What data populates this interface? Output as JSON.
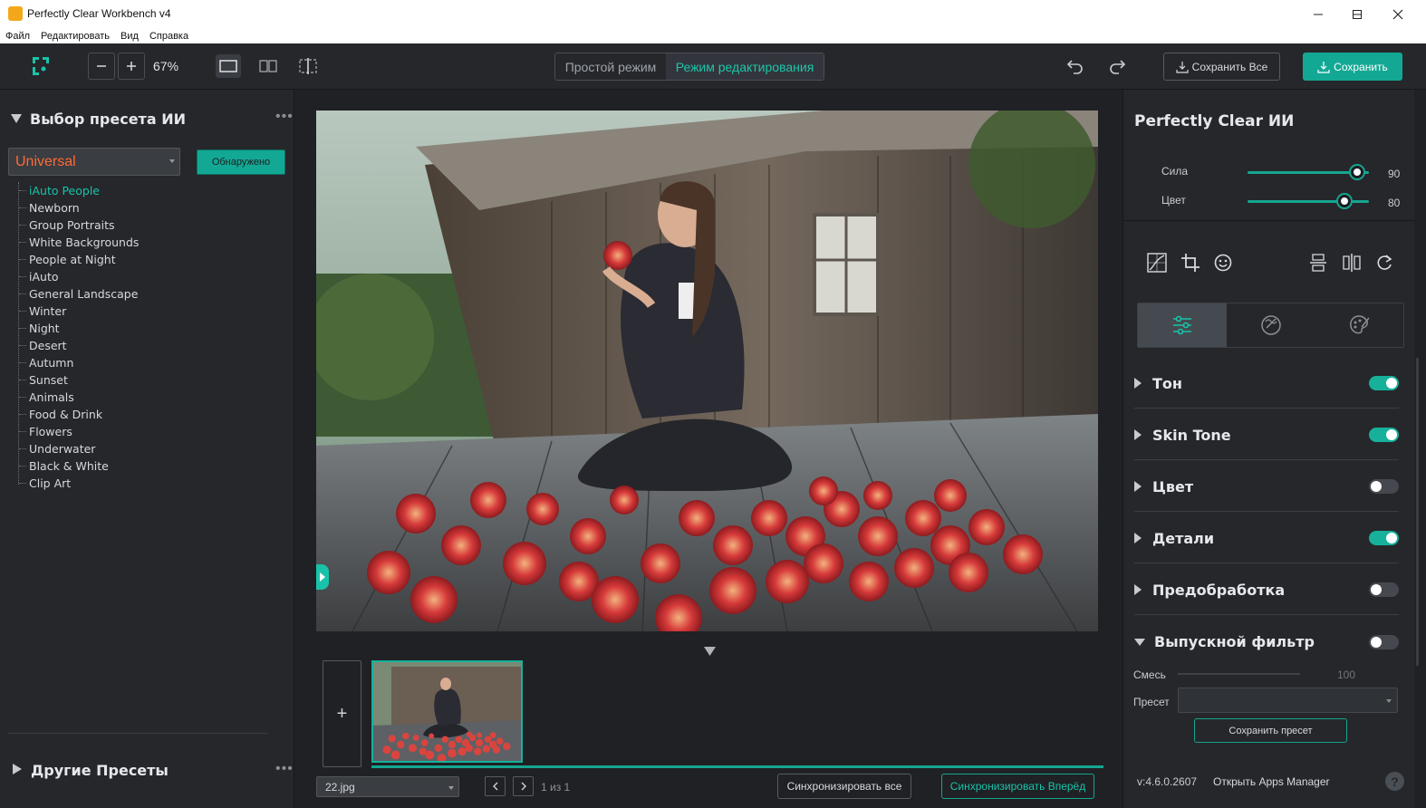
{
  "window": {
    "title": "Perfectly Clear Workbench v4"
  },
  "menu": [
    "Файл",
    "Редактировать",
    "Вид",
    "Справка"
  ],
  "toolbar": {
    "zoom": "67%",
    "mode_simple": "Простой режим",
    "mode_edit": "Режим редактирования",
    "save_all": "Сохранить Все",
    "save": "Сохранить",
    "accent_color": "#13a894"
  },
  "left_panel": {
    "title": "Выбор пресета ИИ",
    "dropdown_value": "Universal",
    "detected_button": "Обнаружено",
    "presets": [
      "iAuto People",
      "Newborn",
      "Group Portraits",
      "White Backgrounds",
      "People at Night",
      "iAuto",
      "General Landscape",
      "Winter",
      "Night",
      "Desert",
      "Autumn",
      "Sunset",
      "Animals",
      "Food & Drink",
      "Flowers",
      "Underwater",
      "Black & White",
      "Clip Art"
    ],
    "selected_preset": "iAuto People",
    "other_presets": "Другие Пресеты"
  },
  "center": {
    "add_label": "+",
    "file_name": "22.jpg",
    "page_info": "1 из 1",
    "sync_all": "Синхронизировать все",
    "sync_forward": "Синхронизировать Вперёд"
  },
  "right_panel": {
    "title": "Perfectly Clear ИИ",
    "sliders": [
      {
        "label": "Сила",
        "value": "90",
        "fraction": 0.9
      },
      {
        "label": "Цвет",
        "value": "80",
        "fraction": 0.8
      }
    ],
    "sections": [
      {
        "label": "Тон",
        "on": true
      },
      {
        "label": "Skin Tone",
        "on": true
      },
      {
        "label": "Цвет",
        "on": false
      },
      {
        "label": "Детали",
        "on": true
      },
      {
        "label": "Предобработка",
        "on": false
      },
      {
        "label": "Выпускной фильтр",
        "on": false
      }
    ],
    "blend_label": "Смесь",
    "blend_value": "100",
    "blend_fraction": 0.0,
    "preset_label": "Пресет",
    "save_preset": "Сохранить пресет",
    "version": "v:4.6.0.2607",
    "apps_manager": "Открыть Apps Manager",
    "help": "?"
  }
}
